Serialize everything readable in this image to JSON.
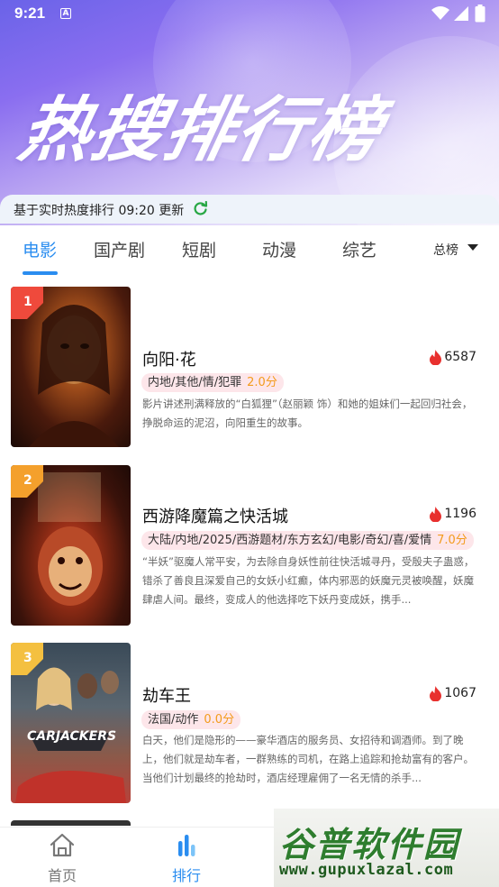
{
  "status": {
    "time": "9:21",
    "a_icon": "A"
  },
  "hero": {
    "title": "热搜排行榜"
  },
  "update_bar": {
    "text": "基于实时热度排行 09:20 更新",
    "refresh_icon": "refresh-icon"
  },
  "tabs": [
    {
      "label": "电影",
      "active": true
    },
    {
      "label": "国产剧",
      "active": false
    },
    {
      "label": "短剧",
      "active": false
    },
    {
      "label": "动漫",
      "active": false
    },
    {
      "label": "综艺",
      "active": false
    }
  ],
  "rank_select": {
    "label": "总榜"
  },
  "items": [
    {
      "rank": "1",
      "title": "向阳·花",
      "heat": "6587",
      "tags": "内地/其他/情/犯罪",
      "score": "2.0分",
      "desc": "影片讲述刑满释放的“白狐狸”（赵丽颖 饰）和她的姐妹们一起回归社会，挣脱命运的泥沼，向阳重生的故事。"
    },
    {
      "rank": "2",
      "title": "西游降魔篇之快活城",
      "heat": "1196",
      "tags": "大陆/内地/2025/西游题材/东方玄幻/电影/奇幻/喜/爱情",
      "score": "7.0分",
      "desc": "“半妖”驱魔人常平安，为去除自身妖性前往快活城寻丹，受殷夫子蛊惑，错杀了善良且深爱自己的女妖小红癫，体内邪恶的妖魔元灵被唤醒，妖魔肆虐人间。最终，变成人的他选择吃下妖丹变成妖，携手..."
    },
    {
      "rank": "3",
      "title": "劫车王",
      "heat": "1067",
      "tags": "法国/动作",
      "score": "0.0分",
      "poster_text": "CARJACKERS",
      "desc": "白天，他们是隐形的——豪华酒店的服务员、女招待和调酒师。到了晚上，他们就是劫车者，一群熟练的司机，在路上追踪和抢劫富有的客户。当他们计划最终的抢劫时，酒店经理雇佣了一名无情的杀手..."
    }
  ],
  "bottom_nav": [
    {
      "label": "首页",
      "icon": "home-icon"
    },
    {
      "label": "排行",
      "icon": "bar-chart-icon"
    }
  ],
  "watermark": {
    "main": "谷普软件园",
    "url": "www.gupuxlazal.com"
  },
  "colors": {
    "accent": "#2a8df0",
    "heat": "#e8302e",
    "score": "#f39b1c",
    "tag_bg": "#fde6ea"
  }
}
